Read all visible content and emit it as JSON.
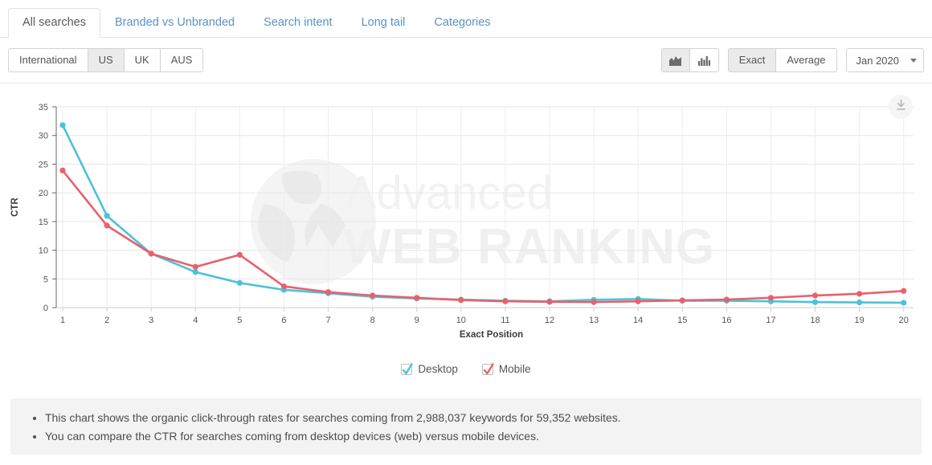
{
  "tabs": [
    {
      "label": "All searches",
      "active": true
    },
    {
      "label": "Branded vs Unbranded",
      "active": false
    },
    {
      "label": "Search intent",
      "active": false
    },
    {
      "label": "Long tail",
      "active": false
    },
    {
      "label": "Categories",
      "active": false
    }
  ],
  "toolbar": {
    "regions": [
      {
        "label": "International",
        "active": false
      },
      {
        "label": "US",
        "active": true
      },
      {
        "label": "UK",
        "active": false
      },
      {
        "label": "AUS",
        "active": false
      }
    ],
    "chart_type_icons": [
      {
        "name": "area-chart-icon",
        "active": true
      },
      {
        "name": "bar-chart-icon",
        "active": false
      }
    ],
    "modes": [
      {
        "label": "Exact",
        "active": true
      },
      {
        "label": "Average",
        "active": false
      }
    ],
    "date_select": {
      "value": "Jan 2020"
    },
    "download_icon": "download-icon"
  },
  "watermark": {
    "line1": "Advanced",
    "line2": "WEB RANKING"
  },
  "legend": [
    {
      "label": "Desktop",
      "color": "#4BC2D9",
      "checked": true
    },
    {
      "label": "Mobile",
      "color": "#E8616D",
      "checked": true
    }
  ],
  "footer": {
    "bullets": [
      "This chart shows the organic click-through rates for searches coming from 2,988,037 keywords for 59,352 websites.",
      "You can compare the CTR for searches coming from desktop devices (web) versus mobile devices."
    ]
  },
  "chart_data": {
    "type": "line",
    "title": "",
    "xlabel": "Exact Position",
    "ylabel": "CTR",
    "x": [
      1,
      2,
      3,
      4,
      5,
      6,
      7,
      8,
      9,
      10,
      11,
      12,
      13,
      14,
      15,
      16,
      17,
      18,
      19,
      20
    ],
    "categories": [
      "1",
      "2",
      "3",
      "4",
      "5",
      "6",
      "7",
      "8",
      "9",
      "10",
      "11",
      "12",
      "13",
      "14",
      "15",
      "16",
      "17",
      "18",
      "19",
      "20"
    ],
    "ylim": [
      0,
      35
    ],
    "yticks": [
      0,
      5,
      10,
      15,
      20,
      25,
      30,
      35
    ],
    "grid": true,
    "legend_position": "bottom",
    "series": [
      {
        "name": "Desktop",
        "color": "#4BC2D9",
        "values": [
          31.8,
          16.0,
          9.4,
          6.2,
          4.3,
          3.1,
          2.5,
          1.9,
          1.6,
          1.4,
          1.2,
          1.1,
          1.35,
          1.5,
          1.2,
          1.2,
          1.1,
          0.95,
          0.9,
          0.85
        ]
      },
      {
        "name": "Mobile",
        "color": "#E8616D",
        "values": [
          23.9,
          14.3,
          9.4,
          7.1,
          9.2,
          3.7,
          2.7,
          2.1,
          1.7,
          1.3,
          1.1,
          1.0,
          0.95,
          1.1,
          1.25,
          1.4,
          1.7,
          2.1,
          2.4,
          2.9
        ]
      }
    ]
  }
}
